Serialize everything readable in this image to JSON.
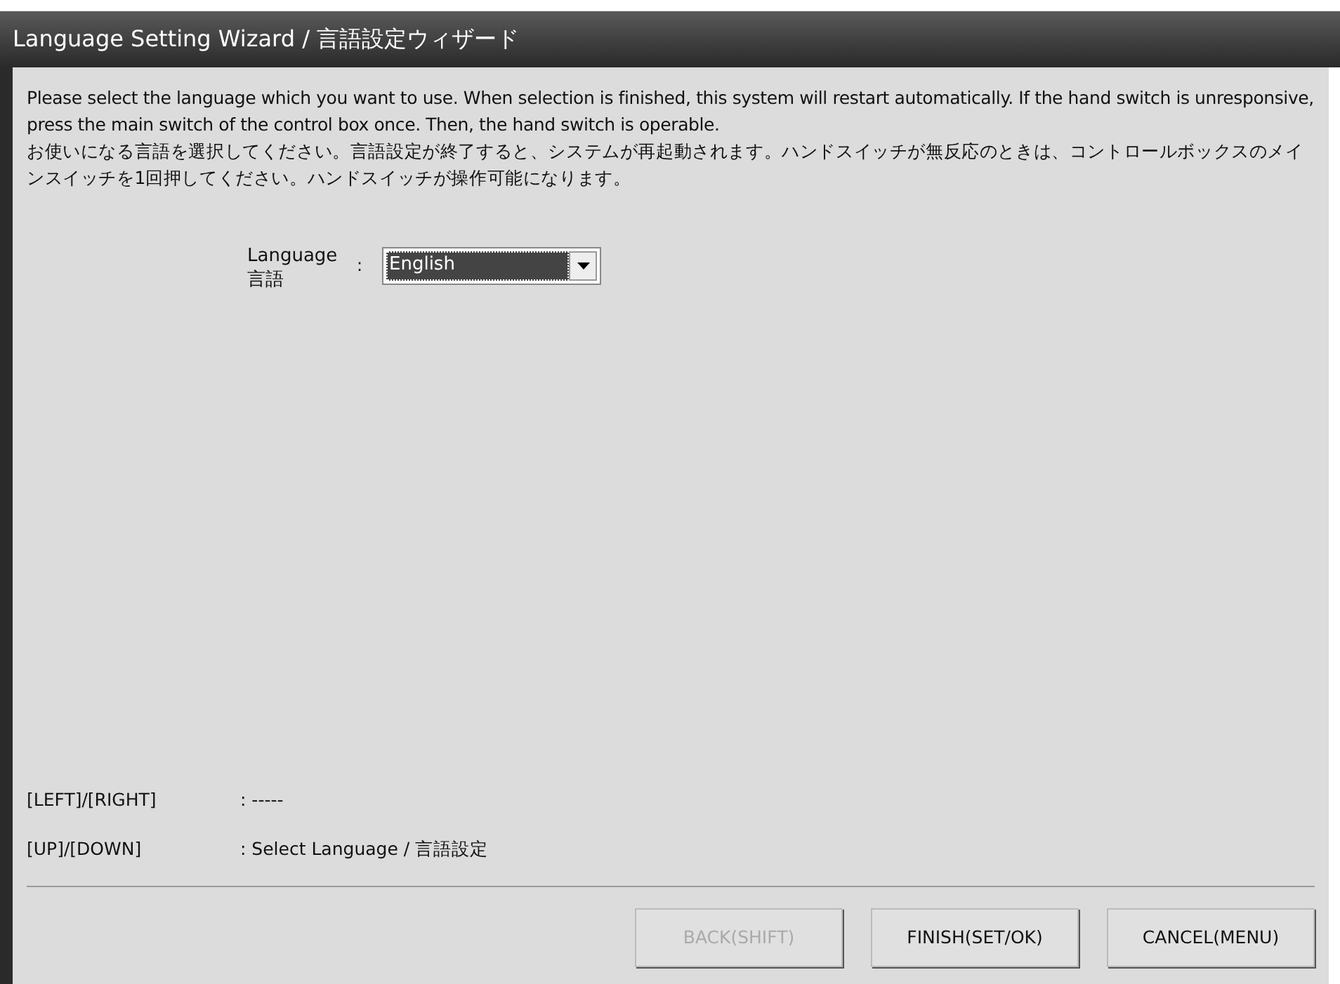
{
  "window": {
    "title": "Language Setting Wizard / 言語設定ウィザード"
  },
  "instructions": [
    "Please select the language which you want to use. When selection is finished, this system will restart automatically. If the hand switch is unresponsive, press the main switch of the control box once. Then, the hand switch is operable.",
    "お使いになる言語を選択してください。言語設定が終了すると、システムが再起動されます。ハンドスイッチが無反応のときは、コントロールボックスのメインスイッチを1回押してください。ハンドスイッチが操作可能になります。"
  ],
  "language_field": {
    "label": "Language",
    "label_ja": "言語",
    "separator": ":",
    "value": "English"
  },
  "key_hints": [
    {
      "keys": "[LEFT]/[RIGHT]",
      "action": ": -----"
    },
    {
      "keys": "[UP]/[DOWN]",
      "action": ": Select Language / 言語設定"
    }
  ],
  "buttons": [
    {
      "label": "BACK(SHIFT)",
      "disabled": true
    },
    {
      "label": "FINISH(SET/OK)",
      "disabled": false
    },
    {
      "label": "CANCEL(MENU)",
      "disabled": false
    }
  ]
}
